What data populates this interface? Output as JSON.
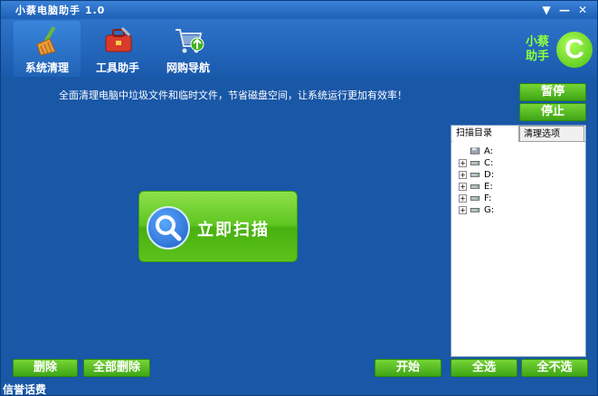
{
  "titlebar": {
    "title": "小蔡电脑助手 1.0",
    "menu_glyph": "▼",
    "min_glyph": "—",
    "close_glyph": "✕"
  },
  "nav": {
    "tabs": [
      {
        "label": "系统清理",
        "icon": "broom-icon",
        "active": true
      },
      {
        "label": "工具助手",
        "icon": "toolbox-icon",
        "active": false
      },
      {
        "label": "网购导航",
        "icon": "shopping-cart-icon",
        "active": false
      }
    ]
  },
  "logo": {
    "text": "小蔡助手",
    "letter": "C"
  },
  "main": {
    "description": "全面清理电脑中垃圾文件和临时文件，节省磁盘空间，让系统运行更加有效率！",
    "pause_label": "暂停",
    "stop_label": "停止",
    "scan_label": "立即扫描"
  },
  "panel": {
    "tab_scan": "扫描目录",
    "tab_options": "清理选项",
    "drives": [
      {
        "label": "A:",
        "expandable": false,
        "icon": "floppy-icon"
      },
      {
        "label": "C:",
        "expandable": true,
        "icon": "hard-drive-icon"
      },
      {
        "label": "D:",
        "expandable": true,
        "icon": "hard-drive-icon"
      },
      {
        "label": "E:",
        "expandable": true,
        "icon": "hard-drive-icon"
      },
      {
        "label": "F:",
        "expandable": true,
        "icon": "hard-drive-icon"
      },
      {
        "label": "G:",
        "expandable": true,
        "icon": "hard-drive-icon"
      }
    ]
  },
  "buttons": {
    "delete": "删除",
    "delete_all": "全部删除",
    "start": "开始",
    "select_all": "全选",
    "select_none": "全不选"
  },
  "footer": {
    "text": "信誉话费"
  },
  "colors": {
    "background": "#1957a7",
    "accent_green": "#5ec620",
    "logo_green": "#8dff3e"
  }
}
